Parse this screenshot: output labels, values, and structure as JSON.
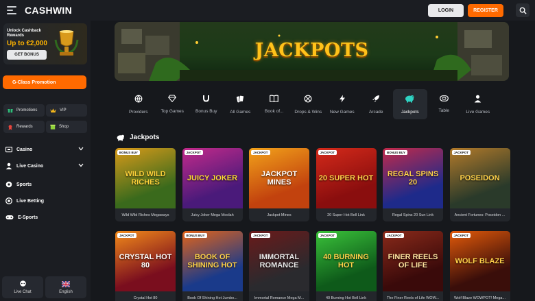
{
  "header": {
    "logo": "CASHWIN",
    "login_label": "LOGIN",
    "register_label": "REGISTER"
  },
  "sidebar": {
    "cashback": {
      "title": "Unlock Cashback Rewards",
      "amount": "Up to €2,000",
      "button_label": "GET BONUS"
    },
    "promotion_label": "G-Class Promotion",
    "tiles": [
      {
        "label": "Promotions",
        "icon": "gift-icon"
      },
      {
        "label": "VIP",
        "icon": "crown-icon"
      },
      {
        "label": "Rewards",
        "icon": "reward-icon"
      },
      {
        "label": "Shop",
        "icon": "shop-icon"
      }
    ],
    "nav": [
      {
        "label": "Casino",
        "icon": "casino-icon",
        "expandable": true
      },
      {
        "label": "Live Casino",
        "icon": "live-casino-icon",
        "expandable": true
      },
      {
        "label": "Sports",
        "icon": "sports-icon",
        "expandable": false
      },
      {
        "label": "Live Betting",
        "icon": "live-betting-icon",
        "expandable": false
      },
      {
        "label": "E-Sports",
        "icon": "esports-icon",
        "expandable": false
      }
    ],
    "live_chat_label": "Live Chat",
    "language_label": "English"
  },
  "banner": {
    "title": "JACKPOTS"
  },
  "categories": [
    {
      "label": "Providers",
      "icon": "providers-icon",
      "active": false
    },
    {
      "label": "Top Games",
      "icon": "diamond-icon",
      "active": false
    },
    {
      "label": "Bonus Buy",
      "icon": "horseshoe-icon",
      "active": false
    },
    {
      "label": "All Games",
      "icon": "cards-icon",
      "active": false
    },
    {
      "label": "Book of...",
      "icon": "book-icon",
      "active": false
    },
    {
      "label": "Drops & Wins",
      "icon": "drops-icon",
      "active": false
    },
    {
      "label": "New Games",
      "icon": "bolt-icon",
      "active": false
    },
    {
      "label": "Arcade",
      "icon": "rocket-icon",
      "active": false
    },
    {
      "label": "Jackpots",
      "icon": "piggy-icon",
      "active": true
    },
    {
      "label": "Table",
      "icon": "table-icon",
      "active": false
    },
    {
      "label": "Live Games",
      "icon": "live-dealer-icon",
      "active": false
    }
  ],
  "section_title": "Jackpots",
  "games": [
    {
      "name": "Wild Wild Riches Megaways",
      "badge": "BONUS BUY",
      "art_text": "WILD WILD RICHES",
      "bg": "#3a6a1c",
      "bg2": "#d89a1a",
      "text_color": "#ffd23a"
    },
    {
      "name": "Juicy Joker Mega Moolah",
      "badge": "JACKPOT",
      "art_text": "JUICY JOKER",
      "bg": "#4a1a7a",
      "bg2": "#c22a8a",
      "text_color": "#ffdd33"
    },
    {
      "name": "Jackpot Mines",
      "badge": "JACKPOT",
      "art_text": "JACKPOT MINES",
      "bg": "#c2420e",
      "bg2": "#f2a21a",
      "text_color": "#ffffff"
    },
    {
      "name": "20 Super Hot Bell Link",
      "badge": "JACKPOT",
      "art_text": "20 SUPER HOT",
      "bg": "#8a0e0e",
      "bg2": "#d42a1a",
      "text_color": "#ffd24a"
    },
    {
      "name": "Regal Spins 20 Sun Link",
      "badge": "BONUS BUY",
      "art_text": "REGAL SPINS 20",
      "bg": "#1e2a8a",
      "bg2": "#c22a4a",
      "text_color": "#ffd24a"
    },
    {
      "name": "Ancient Fortunes: Poseidon ...",
      "badge": "JACKPOT",
      "art_text": "POSEIDON",
      "bg": "#2a3a2a",
      "bg2": "#b27a2a",
      "text_color": "#ffd24a"
    },
    {
      "name": "Crystal Hot 80",
      "badge": "JACKPOT",
      "art_text": "CRYSTAL HOT 80",
      "bg": "#7a0e1e",
      "bg2": "#f28a1a",
      "text_color": "#ffffff"
    },
    {
      "name": "Book Of Shining Hot Jumbo...",
      "badge": "BONUS BUY",
      "art_text": "BOOK OF SHINING HOT",
      "bg": "#1a3a8a",
      "bg2": "#e2641a",
      "text_color": "#ffd24a"
    },
    {
      "name": "Immortal Romance Mega M...",
      "badge": "JACKPOT",
      "art_text": "IMMORTAL ROMANCE",
      "bg": "#2a2a2e",
      "bg2": "#6a1a1a",
      "text_color": "#e8e8e8"
    },
    {
      "name": "40 Burning Hot Bell Link",
      "badge": "JACKPOT",
      "art_text": "40 BURNING HOT",
      "bg": "#0e5a1a",
      "bg2": "#3ac23a",
      "text_color": "#ffd24a"
    },
    {
      "name": "The Finer Reels of Life WOW...",
      "badge": "JACKPOT",
      "art_text": "FINER REELS OF LIFE",
      "bg": "#3a0a0a",
      "bg2": "#8a2a1a",
      "text_color": "#ffe4a0"
    },
    {
      "name": "Wolf Blaze WOWPOT! Mega...",
      "badge": "JACKPOT",
      "art_text": "WOLF BLAZE",
      "bg": "#3a0e0a",
      "bg2": "#e25a0a",
      "text_color": "#ffd24a"
    }
  ]
}
